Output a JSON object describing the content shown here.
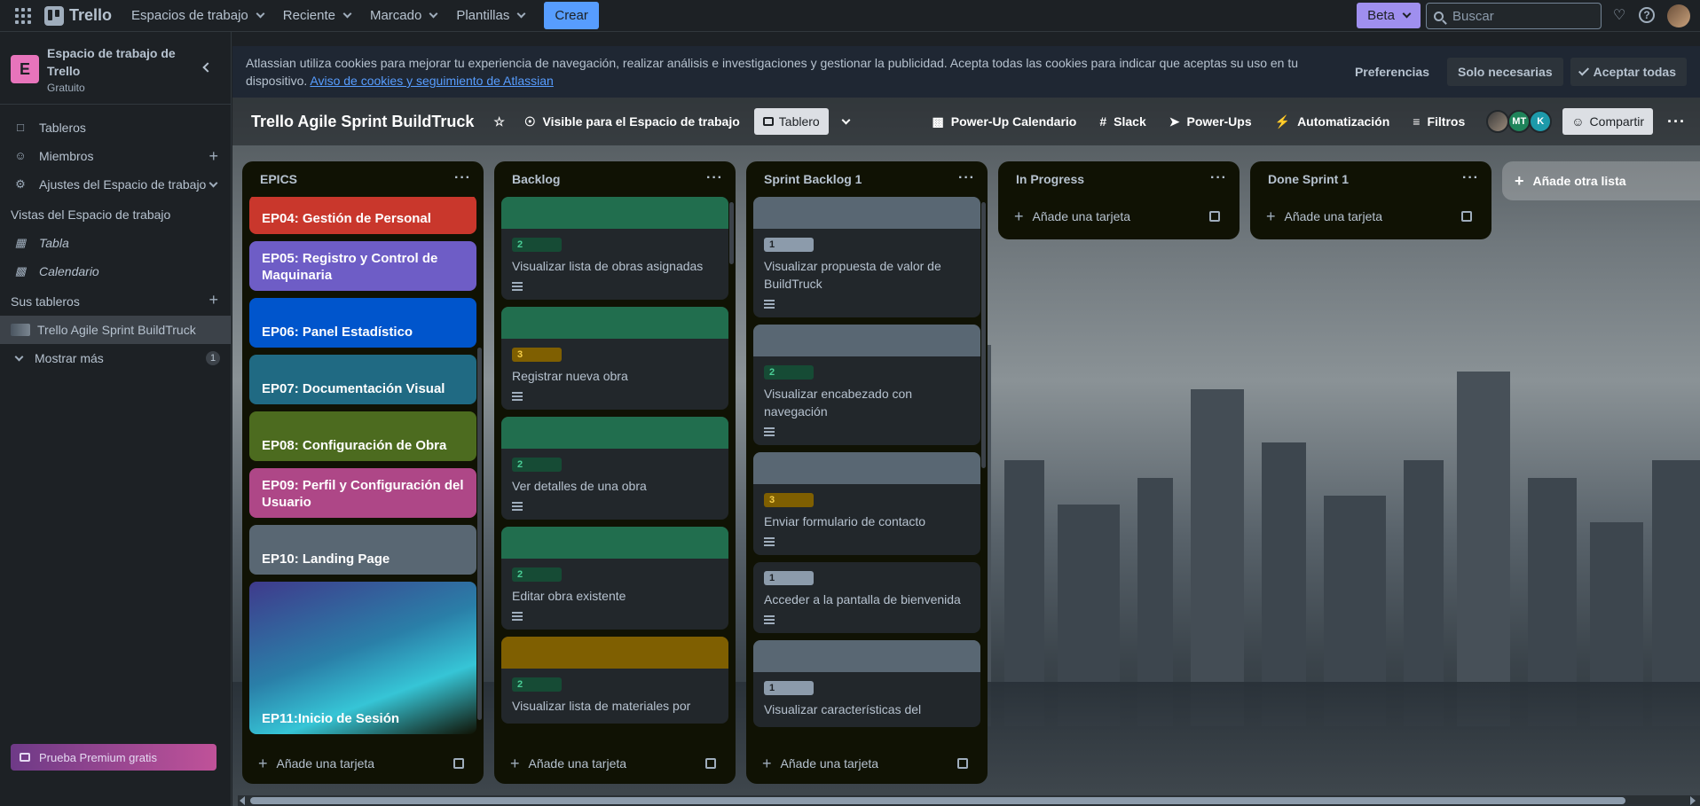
{
  "topbar": {
    "app_name": "Trello",
    "nav": [
      "Espacios de trabajo",
      "Reciente",
      "Marcado",
      "Plantillas"
    ],
    "create_label": "Crear",
    "beta_label": "Beta",
    "search_placeholder": "Buscar"
  },
  "sidebar": {
    "workspace_initial": "E",
    "workspace_name": "Espacio de trabajo de Trello",
    "workspace_plan": "Gratuito",
    "items": [
      {
        "label": "Tableros",
        "icon": "board-icon"
      },
      {
        "label": "Miembros",
        "icon": "person-icon"
      },
      {
        "label": "Ajustes del Espacio de trabajo",
        "icon": "gear-icon"
      }
    ],
    "views_heading": "Vistas del Espacio de trabajo",
    "views": [
      "Tabla",
      "Calendario"
    ],
    "boards_heading": "Sus tableros",
    "boards": [
      "Trello Agile Sprint BuildTruck"
    ],
    "show_more": "Mostrar más",
    "show_more_count": "1",
    "premium_label": "Prueba Premium gratis"
  },
  "cookie": {
    "text": "Atlassian utiliza cookies para mejorar tu experiencia de navegación, realizar análisis e investigaciones y gestionar la publicidad. Acepta todas las cookies para indicar que aceptas su uso en tu dispositivo.",
    "link": "Aviso de cookies y seguimiento de Atlassian",
    "preferences": "Preferencias",
    "only_necessary": "Solo necesarias",
    "accept_all": "Aceptar todas"
  },
  "board": {
    "title": "Trello Agile Sprint BuildTruck",
    "visibility": "Visible para el Espacio de trabajo",
    "view": "Tablero",
    "powerup_calendar": "Power-Up Calendario",
    "slack": "Slack",
    "powerups": "Power-Ups",
    "automation": "Automatización",
    "filters": "Filtros",
    "members": [
      "",
      "MT",
      "K"
    ],
    "share": "Compartir",
    "add_list": "Añade otra lista",
    "add_card": "Añade una tarjeta"
  },
  "lists": {
    "epics": {
      "title": "EPICS",
      "cards": [
        {
          "title": "EP04: Gestión de Personal",
          "color": "#c9372c"
        },
        {
          "title": "EP05: Registro y Control de Maquinaria",
          "color": "#6e5dc6"
        },
        {
          "title": "EP06: Panel Estadístico",
          "color": "#0055cc"
        },
        {
          "title": "EP07: Documentación Visual",
          "color": "#206a83"
        },
        {
          "title": "EP08: Configuración de Obra",
          "color": "#4c6b1f"
        },
        {
          "title": "EP09: Perfil y Configuración del Usuario",
          "color": "#ae4787"
        },
        {
          "title": "EP10: Landing Page",
          "color": "#596773"
        },
        {
          "title": "EP11:Inicio de Sesión",
          "color": "#2b6f8f"
        }
      ]
    },
    "backlog": {
      "title": "Backlog",
      "cards": [
        {
          "label": "2",
          "title": "Visualizar lista de obras asignadas",
          "cover": "#216e4e",
          "label_color": "#164b35",
          "label_text_color": "#4bce97"
        },
        {
          "label": "3",
          "title": "Registrar nueva obra",
          "cover": "#216e4e",
          "label_color": "#7f5f01",
          "label_text_color": "#f5cd47"
        },
        {
          "label": "2",
          "title": "Ver detalles de una obra",
          "cover": "#216e4e",
          "label_color": "#164b35",
          "label_text_color": "#4bce97"
        },
        {
          "label": "2",
          "title": "Editar obra existente",
          "cover": "#216e4e",
          "label_color": "#164b35",
          "label_text_color": "#4bce97"
        },
        {
          "label": "2",
          "title": "Visualizar lista de materiales por",
          "cover": "#7f5f01",
          "label_color": "#164b35",
          "label_text_color": "#4bce97"
        }
      ]
    },
    "sprint": {
      "title": "Sprint Backlog 1",
      "cards": [
        {
          "label": "1",
          "title": "Visualizar propuesta de valor de BuildTruck",
          "cover": "#596773",
          "label_color": "#8c9bab",
          "label_text_color": "#1d2125"
        },
        {
          "label": "2",
          "title": "Visualizar encabezado con navegación",
          "cover": "#596773",
          "label_color": "#164b35",
          "label_text_color": "#4bce97"
        },
        {
          "label": "3",
          "title": "Enviar formulario de contacto",
          "cover": "#596773",
          "label_color": "#7f5f01",
          "label_text_color": "#f5cd47"
        },
        {
          "label": "1",
          "title": "Acceder a la pantalla de bienvenida",
          "cover": "",
          "label_color": "#8c9bab",
          "label_text_color": "#1d2125"
        },
        {
          "label": "1",
          "title": "Visualizar características del",
          "cover": "#596773",
          "label_color": "#8c9bab",
          "label_text_color": "#1d2125"
        }
      ]
    },
    "in_progress": {
      "title": "In Progress"
    },
    "done": {
      "title": "Done Sprint 1"
    }
  }
}
